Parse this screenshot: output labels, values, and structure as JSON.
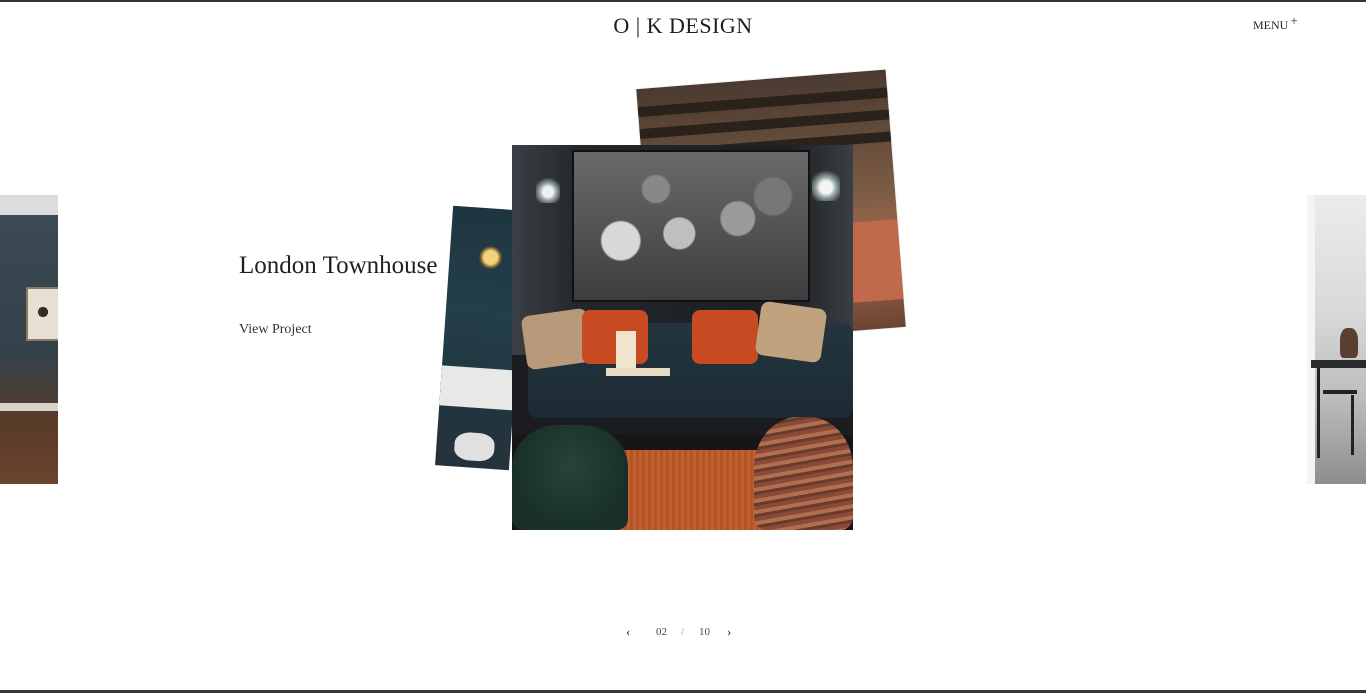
{
  "header": {
    "logo": "O | K DESIGN",
    "menu_label": "MENU",
    "menu_icon": "+"
  },
  "project": {
    "title": "London Townhouse",
    "link_label": "View Project"
  },
  "pager": {
    "prev_icon": "‹",
    "current": "02",
    "separator": "/",
    "total": "10",
    "next_icon": "›"
  },
  "colors": {
    "rule": "#2f3a38",
    "text": "#222222"
  }
}
